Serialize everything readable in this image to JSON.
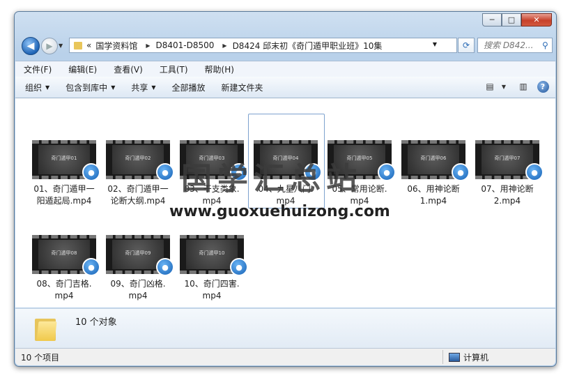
{
  "window": {
    "caption_buttons": {
      "minimize": "─",
      "maximize": "□",
      "close": "✕"
    }
  },
  "address": {
    "history_marker": "«",
    "segments": [
      "国学资料馆",
      "D8401-D8500",
      "D8424 邱末初《奇门遁甲职业班》10集"
    ],
    "search_placeholder": "搜索 D842..."
  },
  "menu": [
    "文件(F)",
    "编辑(E)",
    "查看(V)",
    "工具(T)",
    "帮助(H)"
  ],
  "toolbar": {
    "organize": "组织",
    "include": "包含到库中",
    "share": "共享",
    "play_all": "全部播放",
    "new_folder": "新建文件夹"
  },
  "files": [
    {
      "line1": "01、奇门遁甲一",
      "line2": "阳遁起局.mp4",
      "thumb_title": "奇门遁甲01"
    },
    {
      "line1": "02、奇门遁甲一",
      "line2": "论断大纲.mp4",
      "thumb_title": "奇门遁甲02"
    },
    {
      "line1": "03、干支类象.",
      "line2": "mp4",
      "thumb_title": "奇门遁甲03"
    },
    {
      "line1": "04、九星八门.",
      "line2": "mp4",
      "thumb_title": "奇门遁甲04"
    },
    {
      "line1": "05、常用论断.",
      "line2": "mp4",
      "thumb_title": "奇门遁甲05"
    },
    {
      "line1": "06、用神论断",
      "line2": "1.mp4",
      "thumb_title": "奇门遁甲06"
    },
    {
      "line1": "07、用神论断",
      "line2": "2.mp4",
      "thumb_title": "奇门遁甲07"
    },
    {
      "line1": "08、奇门吉格.",
      "line2": "mp4",
      "thumb_title": "奇门遁甲08"
    },
    {
      "line1": "09、奇门凶格.",
      "line2": "mp4",
      "thumb_title": "奇门遁甲09"
    },
    {
      "line1": "10、奇门四害.",
      "line2": "mp4",
      "thumb_title": "奇门遁甲10"
    }
  ],
  "watermark": {
    "cn": "国学汇总站",
    "url": "www.guoxuehuizong.com"
  },
  "details": {
    "count": "10 个对象"
  },
  "status": {
    "left": "10 个项目",
    "right": "计算机"
  }
}
